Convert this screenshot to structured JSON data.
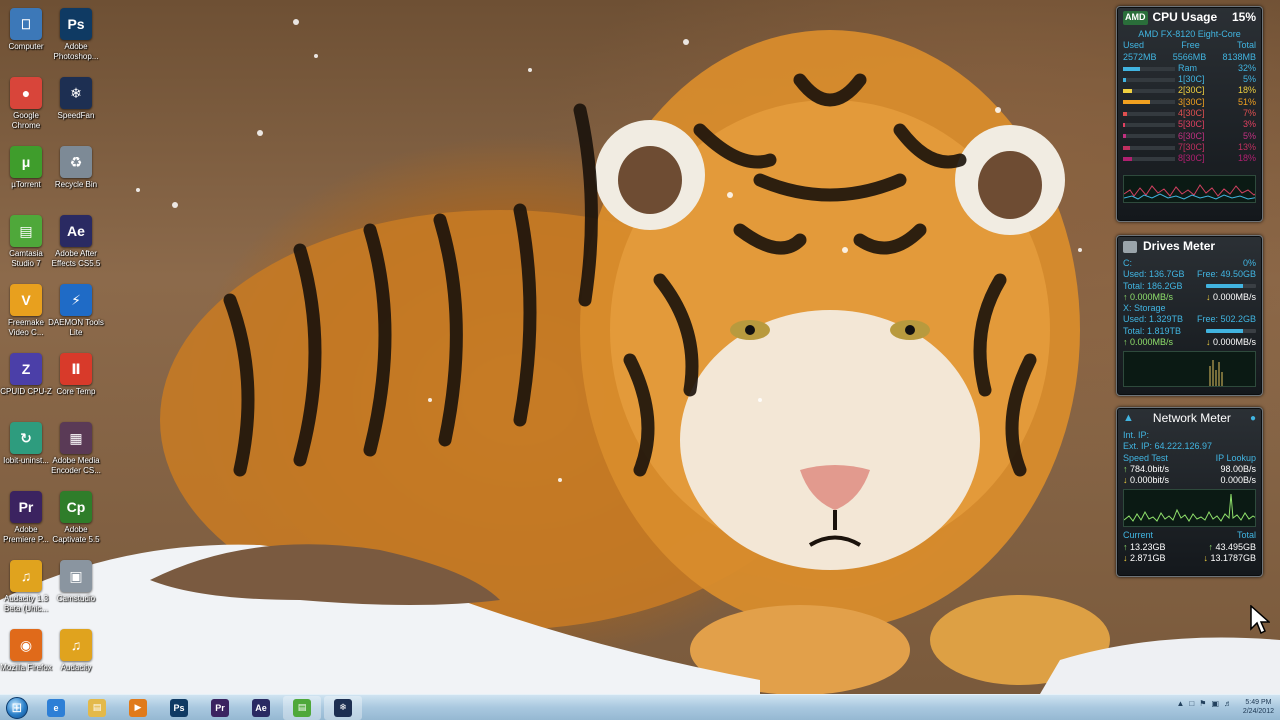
{
  "desktop": {
    "icons": [
      {
        "label": "Computer",
        "glyph": "⎕",
        "color": "#3c78b8"
      },
      {
        "label": "Adobe Photoshop...",
        "glyph": "Ps",
        "color": "#0f3a63"
      },
      {
        "label": "Google Chrome",
        "glyph": "●",
        "color": "#d8453a"
      },
      {
        "label": "SpeedFan",
        "glyph": "❄",
        "color": "#1d2f52"
      },
      {
        "label": "µTorrent",
        "glyph": "μ",
        "color": "#3f9d2c"
      },
      {
        "label": "Recycle Bin",
        "glyph": "♻",
        "color": "#7d8a96"
      },
      {
        "label": "Camtasia Studio 7",
        "glyph": "▤",
        "color": "#4fa83a"
      },
      {
        "label": "Adobe After Effects CS5.5",
        "glyph": "Ae",
        "color": "#2a2a62"
      },
      {
        "label": "Freemake Video C...",
        "glyph": "V",
        "color": "#e8a01e"
      },
      {
        "label": "DAEMON Tools Lite",
        "glyph": "⚡",
        "color": "#1f6bc6"
      },
      {
        "label": "CPUID CPU-Z",
        "glyph": "Z",
        "color": "#4b3fa8"
      },
      {
        "label": "Core Temp",
        "glyph": "Ⅱ",
        "color": "#d83a2a"
      },
      {
        "label": "Iobit-uninst...",
        "glyph": "↻",
        "color": "#2e9c7e"
      },
      {
        "label": "Adobe Media Encoder CS...",
        "glyph": "▦",
        "color": "#5a3a56"
      },
      {
        "label": "Adobe Premiere P...",
        "glyph": "Pr",
        "color": "#3b2360"
      },
      {
        "label": "Adobe Captivate 5.5",
        "glyph": "Cp",
        "color": "#2f7d2a"
      },
      {
        "label": "Audacity 1.3 Beta (Unic...",
        "glyph": "♫",
        "color": "#e0a31e"
      },
      {
        "label": "Camstudio",
        "glyph": "▣",
        "color": "#8a95a0"
      },
      {
        "label": "Mozilla Firefox",
        "glyph": "◉",
        "color": "#e06a1a"
      },
      {
        "label": "Audacity",
        "glyph": "♫",
        "color": "#e0a31e"
      }
    ]
  },
  "cpu_gadget": {
    "brand": "AMD",
    "title": "CPU Usage",
    "total": "15%",
    "model": "AMD FX-8120 Eight-Core",
    "cols": [
      "Used",
      "Free",
      "Total"
    ],
    "mem": [
      "2572MB",
      "5566MB",
      "8138MB"
    ],
    "ram_label": "Ram",
    "ram_pct": "32%",
    "ram_fill": 0.32,
    "cores": [
      {
        "label": "1[30C]",
        "pct": "5%",
        "fill": 0.05,
        "color": "#41b4e0"
      },
      {
        "label": "2[30C]",
        "pct": "18%",
        "fill": 0.18,
        "color": "#f0d040"
      },
      {
        "label": "3[30C]",
        "pct": "51%",
        "fill": 0.51,
        "color": "#f0a020"
      },
      {
        "label": "4[30C]",
        "pct": "7%",
        "fill": 0.07,
        "color": "#e05050"
      },
      {
        "label": "5[30C]",
        "pct": "3%",
        "fill": 0.03,
        "color": "#e04060"
      },
      {
        "label": "6[30C]",
        "pct": "5%",
        "fill": 0.05,
        "color": "#c03080"
      },
      {
        "label": "7[30C]",
        "pct": "13%",
        "fill": 0.13,
        "color": "#c03060"
      },
      {
        "label": "8[30C]",
        "pct": "18%",
        "fill": 0.18,
        "color": "#b02070"
      }
    ]
  },
  "drives_gadget": {
    "title": "Drives Meter",
    "c_label": "C:",
    "c_pct": "0%",
    "c_used": "Used: 136.7GB",
    "c_free": "Free: 49.50GB",
    "c_total": "Total: 186.2GB",
    "c_fill": 0.73,
    "c_read": "0.000MB/s",
    "c_write": "0.000MB/s",
    "x_label": "X: Storage",
    "x_used": "Used: 1.329TB",
    "x_free": "Free: 502.2GB",
    "x_total": "Total: 1.819TB",
    "x_fill": 0.73,
    "x_read": "0.000MB/s",
    "x_write": "0.000MB/s"
  },
  "network_gadget": {
    "title": "Network Meter",
    "int_ip": "Int. IP:",
    "ext_ip": "Ext. IP: 64.222.126.97",
    "speed_test": "Speed Test",
    "ip_lookup": "IP Lookup",
    "up_rate": "784.0bit/s",
    "up_bytes": "98.00B/s",
    "down_rate": "0.000bit/s",
    "down_bytes": "0.000B/s",
    "current_label": "Current",
    "total_label": "Total",
    "cur_up": "13.23GB",
    "tot_up": "43.495GB",
    "cur_down": "2.871GB",
    "tot_down": "13.1787GB"
  },
  "taskbar": {
    "pinned": [
      {
        "name": "ie",
        "glyph": "e",
        "color": "#2d7fd6"
      },
      {
        "name": "explorer",
        "glyph": "▤",
        "color": "#e3b94a"
      },
      {
        "name": "media-player",
        "glyph": "▶",
        "color": "#e07a1a"
      },
      {
        "name": "photoshop",
        "glyph": "Ps",
        "color": "#0f3a63"
      },
      {
        "name": "premiere",
        "glyph": "Pr",
        "color": "#3b2360"
      },
      {
        "name": "after-effects",
        "glyph": "Ae",
        "color": "#2a2a62"
      },
      {
        "name": "camtasia",
        "glyph": "▤",
        "color": "#4fa83a"
      },
      {
        "name": "speedfan",
        "glyph": "❄",
        "color": "#1d2f52"
      }
    ],
    "time": "5:49 PM",
    "date": "2/24/2012"
  }
}
